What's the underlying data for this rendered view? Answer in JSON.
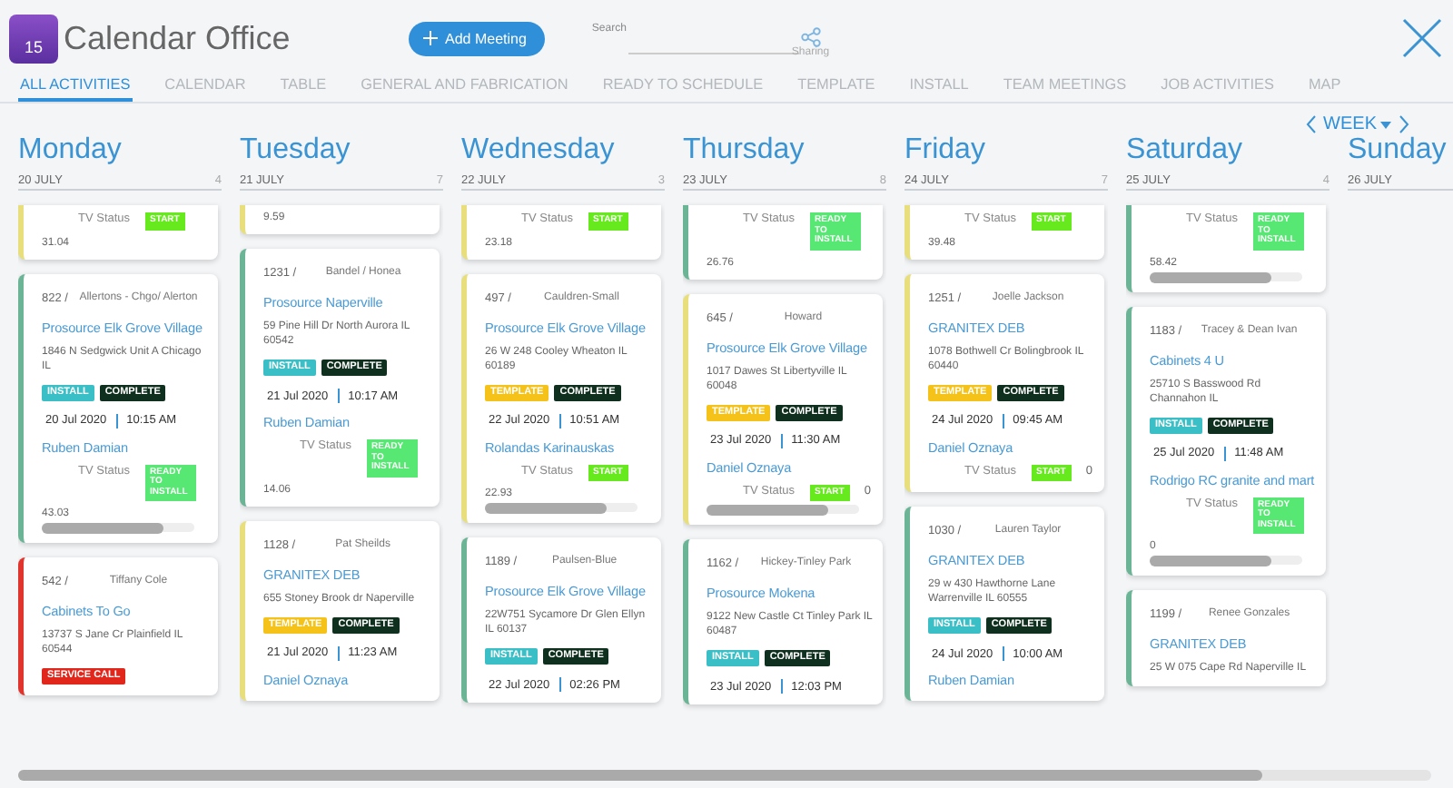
{
  "app": {
    "logo_text": "15",
    "title": "Calendar Office",
    "add_button": "Add Meeting",
    "search": {
      "label": "Search"
    },
    "sharing": "Sharing"
  },
  "tabs": [
    {
      "label": "ALL ACTIVITIES",
      "selected": true
    },
    {
      "label": "CALENDAR",
      "selected": false
    },
    {
      "label": "TABLE",
      "selected": false
    },
    {
      "label": "GENERAL AND FABRICATION",
      "selected": false
    },
    {
      "label": "READY TO SCHEDULE",
      "selected": false
    },
    {
      "label": "TEMPLATE",
      "selected": false
    },
    {
      "label": "INSTALL",
      "selected": false
    },
    {
      "label": "TEAM MEETINGS",
      "selected": false
    },
    {
      "label": "JOB ACTIVITIES",
      "selected": false
    },
    {
      "label": "MAP",
      "selected": false
    }
  ],
  "view": {
    "label": "WEEK"
  },
  "days": [
    {
      "name": "Monday",
      "date": "20 JULY",
      "count": "4",
      "cards": [
        {
          "color": "#e8df7c",
          "status_label": "TV Status",
          "status": {
            "kind": "start",
            "label": "START"
          },
          "number": "31.04"
        },
        {
          "color": "#6bb596",
          "id": "822 /",
          "owner": "Allertons - Chgo/ Alerton",
          "title": "Prosource Elk Grove Village",
          "address": "1846 N Sedgwick Unit A Chicago IL",
          "tags": [
            {
              "kind": "install",
              "label": "INSTALL"
            },
            {
              "kind": "complete",
              "label": "COMPLETE"
            }
          ],
          "date": "20 Jul 2020",
          "time": "10:15 AM",
          "person": "Ruben Damian",
          "status_label": "TV Status",
          "status": {
            "kind": "ready",
            "label": "READY TO INSTALL"
          },
          "number": "43.03",
          "scrollbar": true
        },
        {
          "color": "#e0342c",
          "id": "542 /",
          "owner": "Tiffany Cole",
          "title": "Cabinets To Go",
          "address": "13737 S Jane Cr Plainfield IL 60544",
          "tags": [
            {
              "kind": "service",
              "label": "SERVICE CALL"
            }
          ]
        }
      ]
    },
    {
      "name": "Tuesday",
      "date": "21 JULY",
      "count": "7",
      "cards": [
        {
          "color": "#e8df7c",
          "number": "9.59"
        },
        {
          "color": "#6bb596",
          "id": "1231 /",
          "owner": "Bandel / Honea",
          "title": "Prosource Naperville",
          "address": "59 Pine Hill Dr North Aurora IL 60542",
          "tags": [
            {
              "kind": "install",
              "label": "INSTALL"
            },
            {
              "kind": "complete",
              "label": "COMPLETE"
            }
          ],
          "date": "21 Jul 2020",
          "time": "10:17 AM",
          "person": "Ruben Damian",
          "status_label": "TV Status",
          "status": {
            "kind": "ready",
            "label": "READY TO INSTALL"
          },
          "number": "14.06"
        },
        {
          "color": "#e8df7c",
          "id": "1128 /",
          "owner": "Pat Sheilds",
          "title": "GRANITEX DEB",
          "address": "655 Stoney Brook dr Naperville",
          "tags": [
            {
              "kind": "template",
              "label": "TEMPLATE"
            },
            {
              "kind": "complete",
              "label": "COMPLETE"
            }
          ],
          "date": "21 Jul 2020",
          "time": "11:23 AM",
          "person": "Daniel Oznaya"
        }
      ]
    },
    {
      "name": "Wednesday",
      "date": "22 JULY",
      "count": "3",
      "cards": [
        {
          "color": "#e8df7c",
          "status_label": "TV Status",
          "status": {
            "kind": "start",
            "label": "START"
          },
          "number": "23.18"
        },
        {
          "color": "#e8df7c",
          "id": "497 /",
          "owner": "Cauldren-Small",
          "title": "Prosource Elk Grove Village",
          "address": "26 W 248 Cooley Wheaton IL 60189",
          "tags": [
            {
              "kind": "template",
              "label": "TEMPLATE"
            },
            {
              "kind": "complete",
              "label": "COMPLETE"
            }
          ],
          "date": "22 Jul 2020",
          "time": "10:51 AM",
          "person": "Rolandas Karinauskas",
          "status_label": "TV Status",
          "status": {
            "kind": "start",
            "label": "START"
          },
          "number": "22.93",
          "scrollbar": true
        },
        {
          "color": "#6bb596",
          "id": "1189 /",
          "owner": "Paulsen-Blue",
          "title": "Prosource Elk Grove Village",
          "address": "22W751 Sycamore Dr Glen Ellyn IL 60137",
          "tags": [
            {
              "kind": "install",
              "label": "INSTALL"
            },
            {
              "kind": "complete",
              "label": "COMPLETE"
            }
          ],
          "date": "22 Jul 2020",
          "time": "02:26 PM"
        }
      ]
    },
    {
      "name": "Thursday",
      "date": "23 JULY",
      "count": "8",
      "cards": [
        {
          "color": "#6bb596",
          "status_label": "TV Status",
          "status": {
            "kind": "ready",
            "label": "READY TO INSTALL"
          },
          "number": "26.76"
        },
        {
          "color": "#e8df7c",
          "id": "645 /",
          "owner": "Howard",
          "title": "Prosource Elk Grove Village",
          "address": "1017 Dawes St Libertyville IL 60048",
          "tags": [
            {
              "kind": "template",
              "label": "TEMPLATE"
            },
            {
              "kind": "complete",
              "label": "COMPLETE"
            }
          ],
          "date": "23 Jul 2020",
          "time": "11:30 AM",
          "person": "Daniel Oznaya",
          "status_label": "TV Status",
          "status": {
            "kind": "start",
            "label": "START"
          },
          "status_count": "0",
          "scrollbar": true
        },
        {
          "color": "#6bb596",
          "id": "1162 /",
          "owner": "Hickey-Tinley Park",
          "title": "Prosource Mokena",
          "address": "9122 New Castle Ct Tinley Park IL 60487",
          "tags": [
            {
              "kind": "install",
              "label": "INSTALL"
            },
            {
              "kind": "complete",
              "label": "COMPLETE"
            }
          ],
          "date": "23 Jul 2020",
          "time": "12:03 PM"
        }
      ]
    },
    {
      "name": "Friday",
      "date": "24 JULY",
      "count": "7",
      "cards": [
        {
          "color": "#e8df7c",
          "status_label": "TV Status",
          "status": {
            "kind": "start",
            "label": "START"
          },
          "number": "39.48"
        },
        {
          "color": "#e8df7c",
          "id": "1251 /",
          "owner": "Joelle Jackson",
          "title": "GRANITEX DEB",
          "address": "1078 Bothwell Cr Bolingbrook IL 60440",
          "tags": [
            {
              "kind": "template",
              "label": "TEMPLATE"
            },
            {
              "kind": "complete",
              "label": "COMPLETE"
            }
          ],
          "date": "24 Jul 2020",
          "time": "09:45 AM",
          "person": "Daniel Oznaya",
          "status_label": "TV Status",
          "status": {
            "kind": "start",
            "label": "START"
          },
          "status_count": "0"
        },
        {
          "color": "#6bb596",
          "id": "1030 /",
          "owner": "Lauren Taylor",
          "title": "GRANITEX DEB",
          "address": "29 w 430 Hawthorne Lane Warrenville IL 60555",
          "tags": [
            {
              "kind": "install",
              "label": "INSTALL"
            },
            {
              "kind": "complete",
              "label": "COMPLETE"
            }
          ],
          "date": "24 Jul 2020",
          "time": "10:00 AM",
          "person": "Ruben Damian"
        }
      ]
    },
    {
      "name": "Saturday",
      "date": "25 JULY",
      "count": "4",
      "cards": [
        {
          "color": "#6bb596",
          "status_label": "TV Status",
          "status": {
            "kind": "ready",
            "label": "READY TO INSTALL"
          },
          "number": "58.42",
          "scrollbar": true
        },
        {
          "color": "#6bb596",
          "id": "1183 /",
          "owner": "Tracey & Dean Ivan",
          "title": "Cabinets 4 U",
          "address": "25710 S Basswood Rd Channahon IL",
          "tags": [
            {
              "kind": "install",
              "label": "INSTALL"
            },
            {
              "kind": "complete",
              "label": "COMPLETE"
            }
          ],
          "date": "25 Jul 2020",
          "time": "11:48 AM",
          "person": "Rodrigo RC granite and mart",
          "status_label": "TV Status",
          "status": {
            "kind": "ready",
            "label": "READY TO INSTALL"
          },
          "number": "0",
          "scrollbar": true
        },
        {
          "color": "#6bb596",
          "id": "1199 /",
          "owner": "Renee Gonzales",
          "title": "GRANITEX DEB",
          "address": "25 W 075 Cape Rd Naperville IL"
        }
      ]
    },
    {
      "name": "Sunday",
      "date": "26 JULY"
    }
  ]
}
